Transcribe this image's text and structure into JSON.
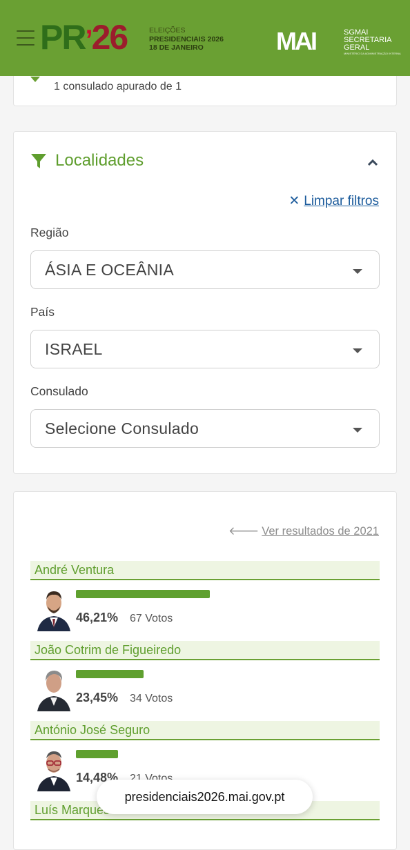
{
  "header": {
    "logo_pr": "PR",
    "logo_year": "26",
    "eleicoes_line1": "ELEIÇÕES",
    "eleicoes_line2": "PRESIDENCIAIS 2026",
    "eleicoes_line3": "18 DE JANEIRO",
    "mai_logo": "MAI",
    "sgmai_line1": "SGMAI",
    "sgmai_line2": "SECRETARIA",
    "sgmai_line3": "GERAL",
    "sgmai_small": "MINISTÉRIO DA ADMINISTRAÇÃO INTERNA",
    "brand_color": "#6aa033"
  },
  "summary": {
    "text": "1 consulado apurado de 1"
  },
  "filters": {
    "title": "Localidades",
    "clear_label": "Limpar filtros",
    "region_label": "Região",
    "region_value": "ÁSIA E OCEÂNIA",
    "country_label": "País",
    "country_value": "ISRAEL",
    "consulate_label": "Consulado",
    "consulate_value": "Selecione Consulado"
  },
  "results": {
    "previous_link": "Ver resultados de 2021",
    "candidates": [
      {
        "name": "André Ventura",
        "percent": "46,21%",
        "votes": "67 Votos",
        "share": 0.4621
      },
      {
        "name": "João Cotrim de Figueiredo",
        "percent": "23,45%",
        "votes": "34 Votos",
        "share": 0.2345
      },
      {
        "name": "António José Seguro",
        "percent": "14,48%",
        "votes": "21 Votos",
        "share": 0.1448
      },
      {
        "name": "Luís Marques Mendes",
        "percent": "",
        "votes": "",
        "share": 0
      }
    ]
  },
  "browser": {
    "url": "presidenciais2026.mai.gov.pt"
  }
}
